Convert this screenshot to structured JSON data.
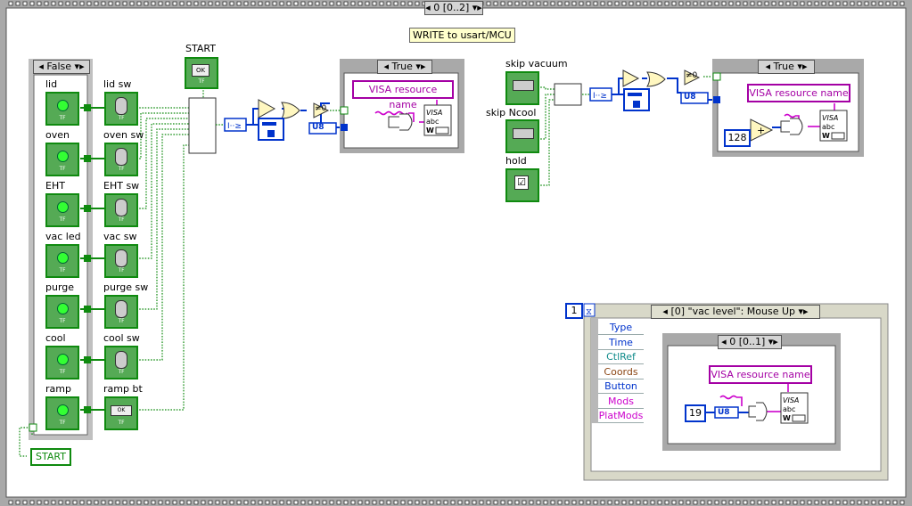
{
  "outer_case": {
    "selector": "0 [0..2]"
  },
  "frame_label": "WRITE to usart/MCU",
  "left_case": {
    "selector": "False"
  },
  "indicators": [
    "lid",
    "oven",
    "EHT",
    "vac led",
    "purge",
    "cool",
    "ramp"
  ],
  "switches": [
    "lid sw",
    "oven sw",
    "EHT sw",
    "vac sw",
    "purge sw",
    "cool sw",
    "ramp bt"
  ],
  "start": {
    "label": "START",
    "local": "START",
    "ok": "OK"
  },
  "ok": "OK",
  "tf": "TF",
  "u8": "U8",
  "neq0": "≠0",
  "visa": "VISA resource name",
  "true_case": {
    "selector": "True"
  },
  "right_true_case": {
    "selector": "True"
  },
  "skip": {
    "vacuum": "skip vacuum",
    "ncool": "skip Ncool",
    "hold": "hold"
  },
  "const_128": "128",
  "event": {
    "count": "1",
    "selector": "[0] \"vac level\": Mouse Up",
    "nodes": [
      "Type",
      "Time",
      "CtlRef",
      "Coords",
      "Button",
      "Mods",
      "PlatMods"
    ],
    "inner_selector": "0 [0..1]",
    "const": "19"
  },
  "colors": {
    "bool": "#0f8a0f",
    "numeric": "#0033cc",
    "string": "#cc00cc",
    "event_blue": "#0033cc",
    "event_brown": "#8b4513"
  }
}
